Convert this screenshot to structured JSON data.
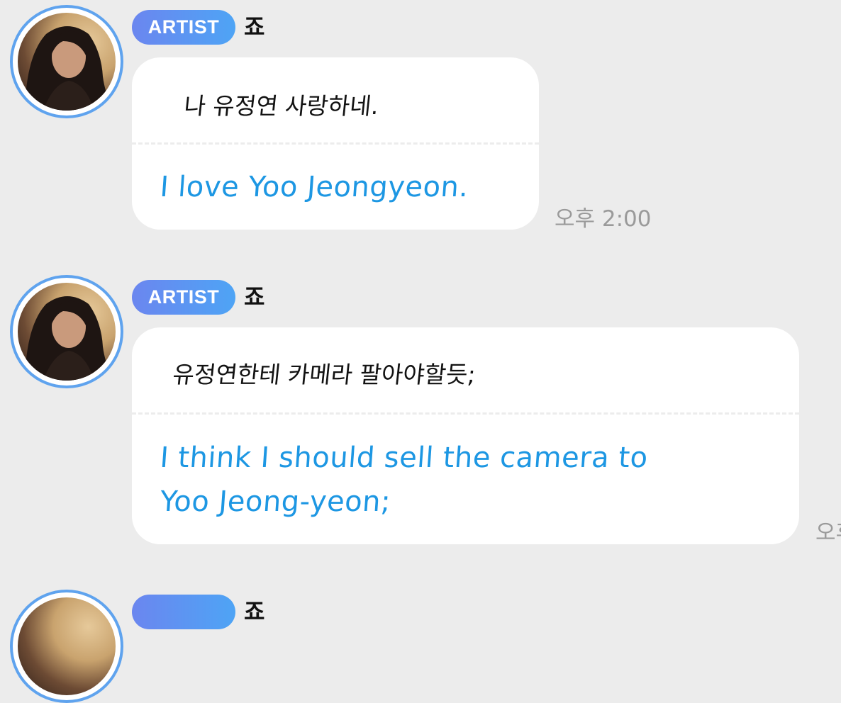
{
  "messages": [
    {
      "badge": "ARTIST",
      "sender": "죠",
      "original": "나 유정연 사랑하네.",
      "translation": "I love Yoo Jeongyeon.",
      "time": "오후 2:00"
    },
    {
      "badge": "ARTIST",
      "sender": "죠",
      "original": "유정연한테 카메라 팔아야할듯;",
      "translation_lines": [
        "I think I should sell the camera to",
        "Yoo Jeong-yeon;"
      ],
      "time": "오후"
    },
    {
      "badge": "",
      "sender": "죠"
    }
  ],
  "colors": {
    "background": "#ececec",
    "bubble": "#ffffff",
    "badge_gradient_start": "#6b86ef",
    "badge_gradient_end": "#4ea4f5",
    "avatar_ring": "#5fa3ee",
    "translation_text": "#1d97e3",
    "timestamp": "#9a9a9a"
  },
  "icons": {
    "avatar": "profile-photo-avatar"
  }
}
